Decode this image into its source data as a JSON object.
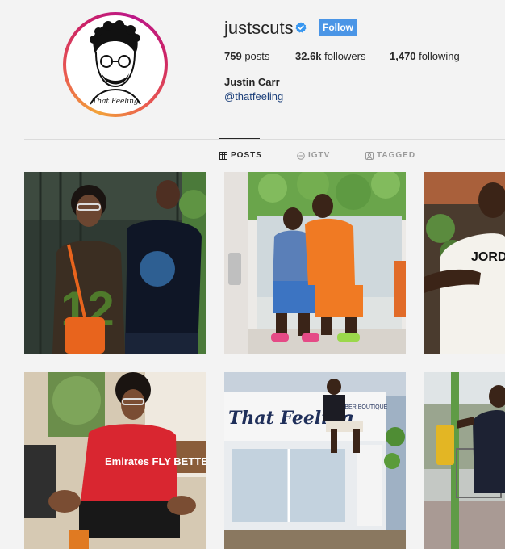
{
  "profile": {
    "username": "justscuts",
    "follow_label": "Follow",
    "posts_count": "759",
    "posts_label": "posts",
    "followers_count": "32.6k",
    "followers_label": "followers",
    "following_count": "1,470",
    "following_label": "following",
    "full_name": "Justin Carr",
    "handle": "@thatfeeling",
    "avatar_caption": "That Feeling"
  },
  "tabs": [
    {
      "label": "POSTS",
      "active": true,
      "icon": "grid-icon"
    },
    {
      "label": "IGTV",
      "active": false,
      "icon": "igtv-icon"
    },
    {
      "label": "TAGGED",
      "active": false,
      "icon": "tagged-icon"
    }
  ],
  "posts": [
    {
      "name": "post-1"
    },
    {
      "name": "post-2"
    },
    {
      "name": "post-3",
      "text": "JORDA"
    },
    {
      "name": "post-4",
      "text": "Emirates FLY BETTER"
    },
    {
      "name": "post-5",
      "text": "That Feeling",
      "subtext": "BARBER BOUTIQUE"
    },
    {
      "name": "post-6"
    }
  ],
  "colors": {
    "follow_button": "#4a95e6",
    "handle_link": "#1b3f7a",
    "verified_badge": "#3897f0",
    "background": "#f3f3f3"
  }
}
